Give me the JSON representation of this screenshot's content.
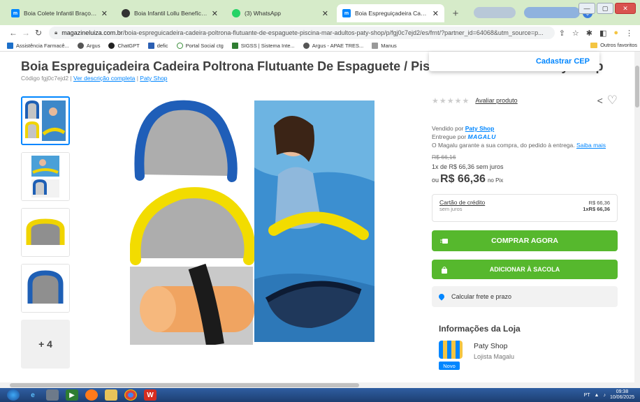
{
  "tabs": [
    {
      "title": "Boia Colete Infantil Braço Person",
      "icon": "magalu-favicon",
      "active": false
    },
    {
      "title": "Boia Infantil Lollu Benefícios",
      "icon": "lollu-favicon",
      "active": false
    },
    {
      "title": "(3) WhatsApp",
      "icon": "whatsapp-favicon",
      "active": false
    },
    {
      "title": "Boia Espreguiçadeira Cadeira Pol",
      "icon": "magalu-favicon",
      "active": true
    }
  ],
  "tab_close": "✕",
  "new_tab": "+",
  "address": {
    "host": "magazineluiza.com.br",
    "path": "/boia-espreguicadeira-cadeira-poltrona-flutuante-de-espaguete-piscina-mar-adultos-paty-shop/p/fgj0c7ejd2/es/frnt/?partner_id=64068&utm_source=p..."
  },
  "bookmarks": [
    "Assistência Farmacê...",
    "Argus",
    "ChatGPT",
    "defic",
    "Portal Social ctg",
    "SIGSS | Sistema Inte...",
    "Argus - APAE TRES...",
    "Manus"
  ],
  "bookmarks_other": "Outros favoritos",
  "product": {
    "title": "Boia Espreguiçadeira Cadeira Poltrona Flutuante De Espaguete / Piscina Mar Adultos - Paty Shop",
    "code_prefix": "Código fgj0c7ejd2 |",
    "full_description_link": "Ver descrição completa",
    "brand_link": "Paty Shop",
    "more_images": "+ 4"
  },
  "cep": {
    "label": "Cadastrar CEP"
  },
  "rating": {
    "stars": "★★★★★",
    "rate_link": "Avaliar produto"
  },
  "seller": {
    "sold_by_prefix": "Vendido por",
    "sold_by": "Paty Shop",
    "delivered_by_prefix": "Entregue por",
    "delivered_by": "MAGALU",
    "guarantee": "O Magalu garante a sua compra, do pedido à entrega.",
    "learn_more": "Saiba mais"
  },
  "price": {
    "old": "R$ 66,16",
    "installment": "1x de R$ 66,36 sem juros",
    "ou": "ou",
    "current": "R$ 66,36",
    "pix": "no Pix"
  },
  "payment": {
    "card": "Cartão de crédito",
    "card_sub": "sem juros",
    "card_total": "R$ 66,36",
    "card_installment": "1xR$ 66,36"
  },
  "actions": {
    "buy_now": "COMPRAR AGORA",
    "add_to_bag": "ADICIONAR À SACOLA",
    "freight": "Calcular frete e prazo"
  },
  "store": {
    "section_title": "Informações da Loja",
    "name": "Paty Shop",
    "subtitle": "Lojista Magalu",
    "badge": "Novo"
  },
  "taskbar": {
    "lang": "PT",
    "time": "09:38",
    "date": "10/06/2025"
  },
  "colors": {
    "brand_blue": "#0086ff",
    "buy_green": "#56b82d",
    "tab_bar": "#d6ebc9"
  }
}
